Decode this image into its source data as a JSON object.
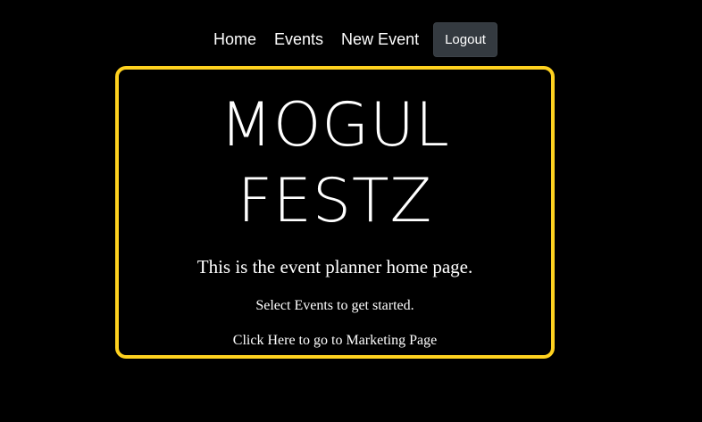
{
  "nav": {
    "items": [
      {
        "label": "Home"
      },
      {
        "label": "Events"
      },
      {
        "label": "New Event"
      }
    ],
    "logout_label": "Logout"
  },
  "hero": {
    "title_line1": "MOGUL",
    "title_line2": "FESTZ",
    "subtitle": "This is the event planner home page.",
    "instruction": "Select Events to get started.",
    "marketing_link": "Click Here to go to Marketing Page"
  },
  "colors": {
    "background": "#000000",
    "accent_border": "#ffd21f",
    "logout_button": "#343a40",
    "text": "#ffffff"
  }
}
